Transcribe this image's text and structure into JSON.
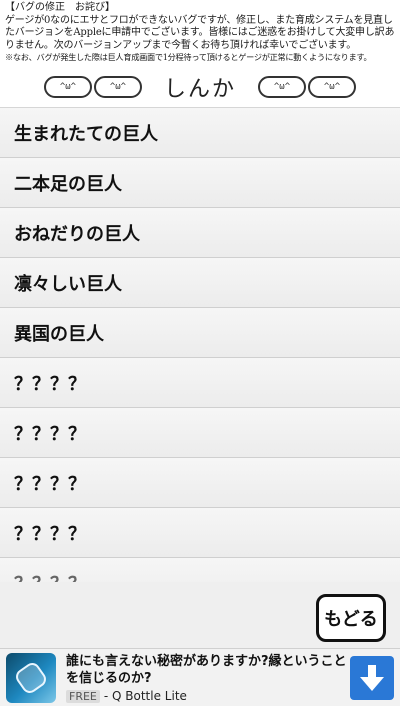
{
  "notice": {
    "title": "【バグの修正　お詫び】",
    "body": "ゲージが0なのにエサとフロができないバグですが、修正し、また育成システムを見直したバージョンをAppleに申請中でございます。皆様にはご迷惑をお掛けして大変申し訳ありません。次のバージョンアップまで今暫くお待ち頂ければ幸いでございます。",
    "note": "※なお、バグが発生した際は巨人育成画面で1分程待って頂けるとゲージが正常に動くようになります。"
  },
  "header": {
    "title": "しんか",
    "mascot_face": "^ω^"
  },
  "list": {
    "items": [
      {
        "label": "生まれたての巨人"
      },
      {
        "label": "二本足の巨人"
      },
      {
        "label": "おねだりの巨人"
      },
      {
        "label": "凛々しい巨人"
      },
      {
        "label": "異国の巨人"
      },
      {
        "label": "？？？？"
      },
      {
        "label": "？？？？"
      },
      {
        "label": "？？？？"
      },
      {
        "label": "？？？？"
      },
      {
        "label": "？？？？"
      }
    ]
  },
  "back_button": {
    "label": "もどる"
  },
  "ad": {
    "title": "誰にも言えない秘密がありますか?縁ということを信じるのか?",
    "free": "FREE",
    "app_name": "- Q Bottle Lite",
    "icon": "bottle-icon",
    "download_icon": "download-arrow-icon",
    "accent": "#2a78d6"
  }
}
